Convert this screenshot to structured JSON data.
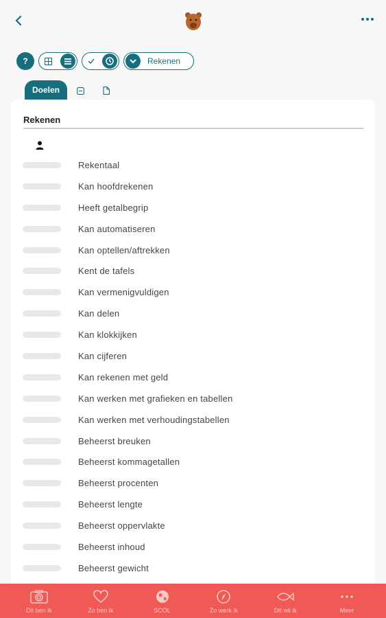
{
  "header": {
    "back_icon": "chevron-left-icon",
    "logo_icon": "bear-logo-icon",
    "more_icon": "more-horizontal-icon"
  },
  "toolbar": {
    "help_label": "?",
    "view_grid_icon": "grid-icon",
    "view_list_icon": "list-icon",
    "filter_check_icon": "check-icon",
    "filter_clock_icon": "clock-icon",
    "subject_dropdown_icon": "chevron-down-icon",
    "subject_label": "Rekenen"
  },
  "tabs": {
    "goals_label": "Doelen",
    "tab2_icon": "minus-square-icon",
    "tab3_icon": "document-icon"
  },
  "card": {
    "title": "Rekenen",
    "person_icon": "person-icon"
  },
  "goals": [
    {
      "label": "Rekentaal",
      "progress": 0
    },
    {
      "label": "Kan hoofdrekenen",
      "progress": 0
    },
    {
      "label": "Heeft getalbegrip",
      "progress": 0
    },
    {
      "label": "Kan automatiseren",
      "progress": 0
    },
    {
      "label": "Kan optellen/aftrekken",
      "progress": 0
    },
    {
      "label": "Kent de tafels",
      "progress": 0
    },
    {
      "label": "Kan vermenigvuldigen",
      "progress": 0
    },
    {
      "label": "Kan delen",
      "progress": 0
    },
    {
      "label": "Kan klokkijken",
      "progress": 0
    },
    {
      "label": "Kan cijferen",
      "progress": 0
    },
    {
      "label": "Kan rekenen met geld",
      "progress": 0
    },
    {
      "label": "Kan werken met grafieken en tabellen",
      "progress": 0
    },
    {
      "label": "Kan werken met verhoudingstabellen",
      "progress": 0
    },
    {
      "label": "Beheerst breuken",
      "progress": 0
    },
    {
      "label": "Beheerst kommagetallen",
      "progress": 0
    },
    {
      "label": "Beheerst procenten",
      "progress": 0
    },
    {
      "label": "Beheerst lengte",
      "progress": 0
    },
    {
      "label": "Beheerst oppervlakte",
      "progress": 0
    },
    {
      "label": "Beheerst inhoud",
      "progress": 0
    },
    {
      "label": "Beheerst gewicht",
      "progress": 0
    }
  ],
  "bottom_nav": [
    {
      "label": "Dit ben ik",
      "icon": "camera-icon"
    },
    {
      "label": "Zo ben ik",
      "icon": "heart-icon"
    },
    {
      "label": "SCOL",
      "icon": "globe-icon"
    },
    {
      "label": "Zo werk ik",
      "icon": "compass-icon"
    },
    {
      "label": "Dit wil ik",
      "icon": "fish-icon"
    },
    {
      "label": "Meer",
      "icon": "more-horizontal-icon"
    }
  ],
  "colors": {
    "primary": "#176f7e",
    "nav_bar": "#ef5a57",
    "background": "#f7f7f7",
    "track": "#e8e8e8"
  }
}
